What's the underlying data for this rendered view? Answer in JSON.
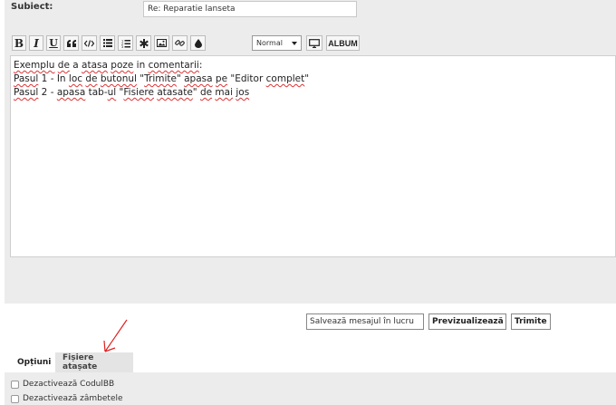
{
  "form": {
    "subject_label": "Subiect:",
    "subject_value": "Re: Reparatie lanseta"
  },
  "toolbar": {
    "bold": "B",
    "italic": "I",
    "underline": "U",
    "font_size_value": "Normal",
    "album_label": "ALBUM",
    "icons": [
      "bold-icon",
      "italic-icon",
      "underline-icon",
      "quote-icon",
      "code-icon",
      "list-icon",
      "ordered-list-icon",
      "asterisk-icon",
      "image-icon",
      "link-icon",
      "color-icon",
      "screen-icon"
    ]
  },
  "editor": {
    "lines": [
      [
        "Exemplu",
        " ",
        "de",
        " a ",
        "atasa",
        " ",
        "poze",
        " in ",
        "comentarii",
        ":"
      ],
      [
        "Pasul",
        " 1 - In ",
        "loc",
        " ",
        "de",
        " ",
        "butonul",
        " \"",
        "Trimite",
        "\" ",
        "apasa",
        " ",
        "pe",
        " \"Editor ",
        "complet",
        "\""
      ],
      [
        "Pasul",
        " 2 - ",
        "apasa",
        " tab-",
        "ul",
        " \"",
        "Fisiere",
        " ",
        "atasate",
        "\" ",
        "de",
        " ",
        "mai",
        " ",
        "jos"
      ]
    ]
  },
  "actions": {
    "save_draft": "Salvează mesajul în lucru",
    "preview": "Previzualizează",
    "submit": "Trimite"
  },
  "tabs": {
    "options": "Opțiuni",
    "attachments": "Fișiere atașate"
  },
  "options": {
    "items": [
      "Dezactivează CodulBB",
      "Dezactivează zâmbetele"
    ]
  },
  "colors": {
    "panel_bg": "#ececec",
    "annotation_red": "#e02020",
    "spell_underline": "#dd3333"
  }
}
